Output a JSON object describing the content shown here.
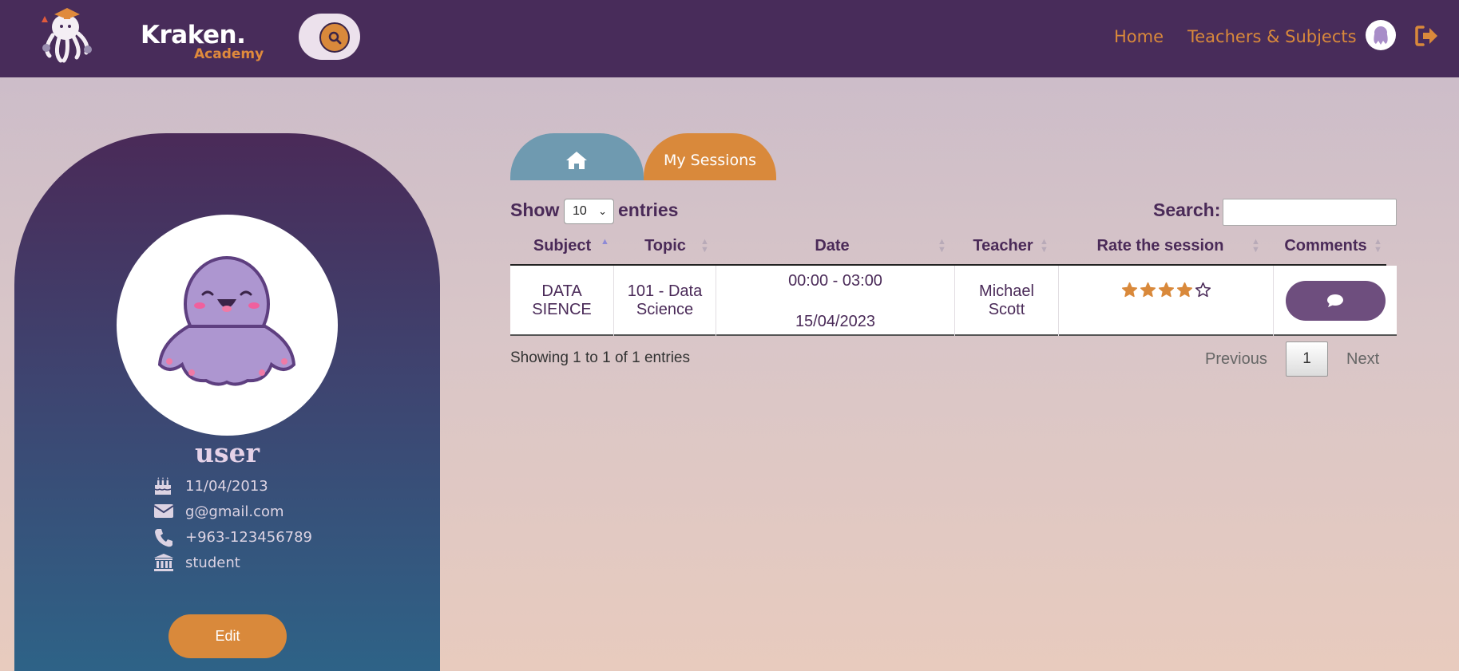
{
  "brand": {
    "name": "Kraken.",
    "sub": "Academy"
  },
  "nav": {
    "home": "Home",
    "teachers": "Teachers & Subjects"
  },
  "profile": {
    "username": "user",
    "birthdate": "11/04/2013",
    "email": "g@gmail.com",
    "phone": "+963-123456789",
    "role": "student",
    "edit_label": "Edit"
  },
  "tabs": {
    "sessions": "My Sessions"
  },
  "table": {
    "show_label": "Show",
    "page_size": "10",
    "entries_label": "entries",
    "search_label": "Search:",
    "search_value": "",
    "headers": [
      "Subject",
      "Topic",
      "Date",
      "Teacher",
      "Rate the session",
      "Comments"
    ],
    "rows": [
      {
        "subject_l1": "DATA",
        "subject_l2": "SIENCE",
        "topic_l1": "101 - Data",
        "topic_l2": "Science",
        "time": "00:00 - 03:00",
        "date": "15/04/2023",
        "teacher_l1": "Michael",
        "teacher_l2": "Scott",
        "rating": 4,
        "rating_max": 5
      }
    ],
    "info": "Showing 1 to 1 of 1 entries",
    "pagination": {
      "previous": "Previous",
      "current": "1",
      "next": "Next"
    }
  },
  "colors": {
    "header": "#482c5a",
    "accent": "#d9893b",
    "card_top": "#4a2a58",
    "card_bottom": "#2d6488"
  }
}
